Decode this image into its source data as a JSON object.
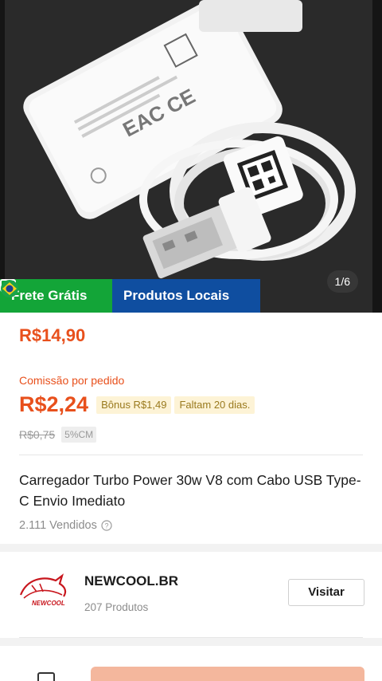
{
  "image": {
    "counter": "1/6",
    "badges": [
      {
        "label": "Frete Grátis",
        "icon": "ticket-icon",
        "color": "#13a538"
      },
      {
        "label": "Produtos Locais",
        "icon": "brazil-flag-icon",
        "color": "#0f4ea0"
      }
    ]
  },
  "pricing": {
    "price": "R$14,90",
    "commission_label": "Comissão por pedido",
    "commission_value": "R$2,24",
    "bonus": "Bônus R$1,49",
    "deadline": "Faltam 20 dias.",
    "old_commission": "R$0,75",
    "rate": "5%CM",
    "accent_color": "#e8501c"
  },
  "product": {
    "title": "Carregador Turbo Power 30w V8 com Cabo USB Type-C Envio Imediato",
    "sold": "2.111 Vendidos"
  },
  "shop": {
    "name": "NEWCOOL.BR",
    "products": "207 Produtos",
    "visit_label": "Visitar",
    "logo_text": "NEWCOOL"
  }
}
